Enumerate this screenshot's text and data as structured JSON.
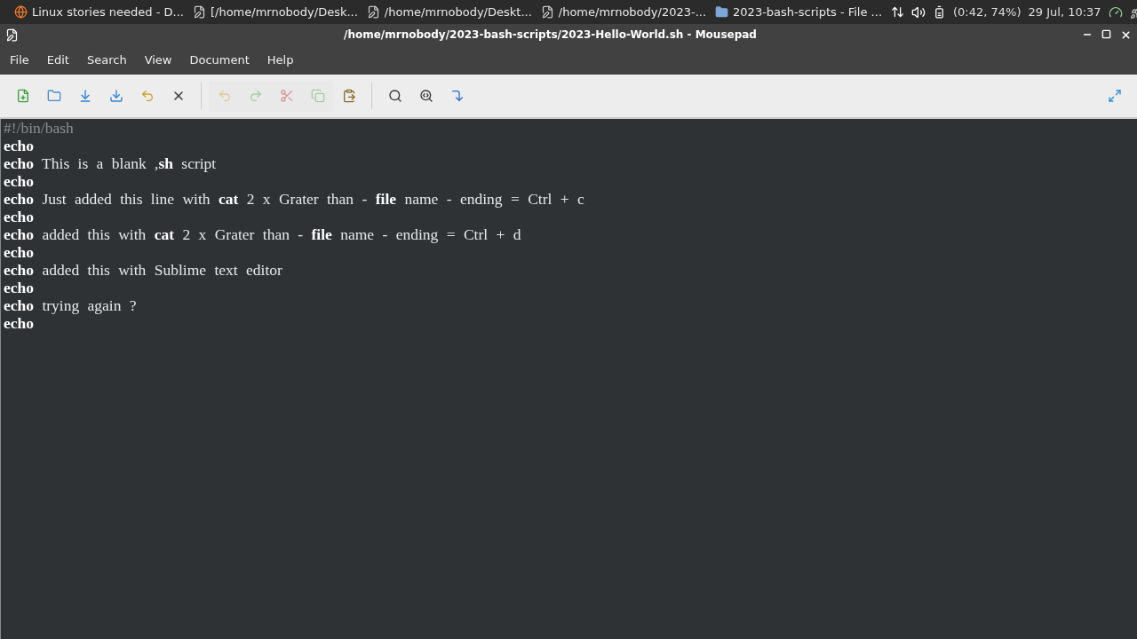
{
  "taskbar": {
    "tasks": [
      {
        "kind": "browser",
        "label": "Linux stories needed - D..."
      },
      {
        "kind": "editor",
        "label": "[/home/mrnobody/Desk..."
      },
      {
        "kind": "editor",
        "label": "/home/mrnobody/Deskt..."
      },
      {
        "kind": "editor",
        "label": "/home/mrnobody/2023-..."
      },
      {
        "kind": "folder",
        "label": "2023-bash-scripts - File ..."
      }
    ],
    "battery": "(0:42, 74%)",
    "clock": "29 Jul, 10:37"
  },
  "window": {
    "title": "/home/mrnobody/2023-bash-scripts/2023-Hello-World.sh - Mousepad"
  },
  "menu": [
    "File",
    "Edit",
    "Search",
    "View",
    "Document",
    "Help"
  ],
  "toolbar": [
    {
      "buttons": [
        {
          "kind": "new",
          "disabled": false
        },
        {
          "kind": "open",
          "disabled": false
        },
        {
          "kind": "save",
          "disabled": false
        },
        {
          "kind": "save-as",
          "disabled": false
        },
        {
          "kind": "revert",
          "disabled": false
        },
        {
          "kind": "close",
          "disabled": false
        }
      ]
    },
    {
      "buttons": [
        {
          "kind": "undo",
          "disabled": true
        },
        {
          "kind": "redo",
          "disabled": true
        },
        {
          "kind": "cut",
          "disabled": true
        },
        {
          "kind": "copy",
          "disabled": true
        },
        {
          "kind": "paste",
          "disabled": false
        }
      ]
    },
    {
      "buttons": [
        {
          "kind": "find",
          "disabled": false
        },
        {
          "kind": "find-next",
          "disabled": false
        },
        {
          "kind": "goto",
          "disabled": false
        }
      ]
    }
  ],
  "editor": {
    "lines": [
      {
        "kind": "comment",
        "text": "#!/bin/bash"
      },
      {
        "kind": "code",
        "text": "**echo**"
      },
      {
        "kind": "code",
        "text": "**echo** This is a blank ,**sh** script"
      },
      {
        "kind": "code",
        "text": "**echo**"
      },
      {
        "kind": "code",
        "text": "**echo** Just added this line with **cat** 2 x Grater than - **file** name - ending = Ctrl + c"
      },
      {
        "kind": "code",
        "text": "**echo**"
      },
      {
        "kind": "code",
        "text": "**echo** added this with **cat** 2 x Grater than - **file** name - ending = Ctrl + d"
      },
      {
        "kind": "code",
        "text": "**echo**"
      },
      {
        "kind": "code",
        "text": "**echo** added this with Sublime text editor"
      },
      {
        "kind": "code",
        "text": "**echo**"
      },
      {
        "kind": "code",
        "text": "**echo** trying again ?"
      },
      {
        "kind": "code",
        "text": "**echo**"
      }
    ]
  }
}
